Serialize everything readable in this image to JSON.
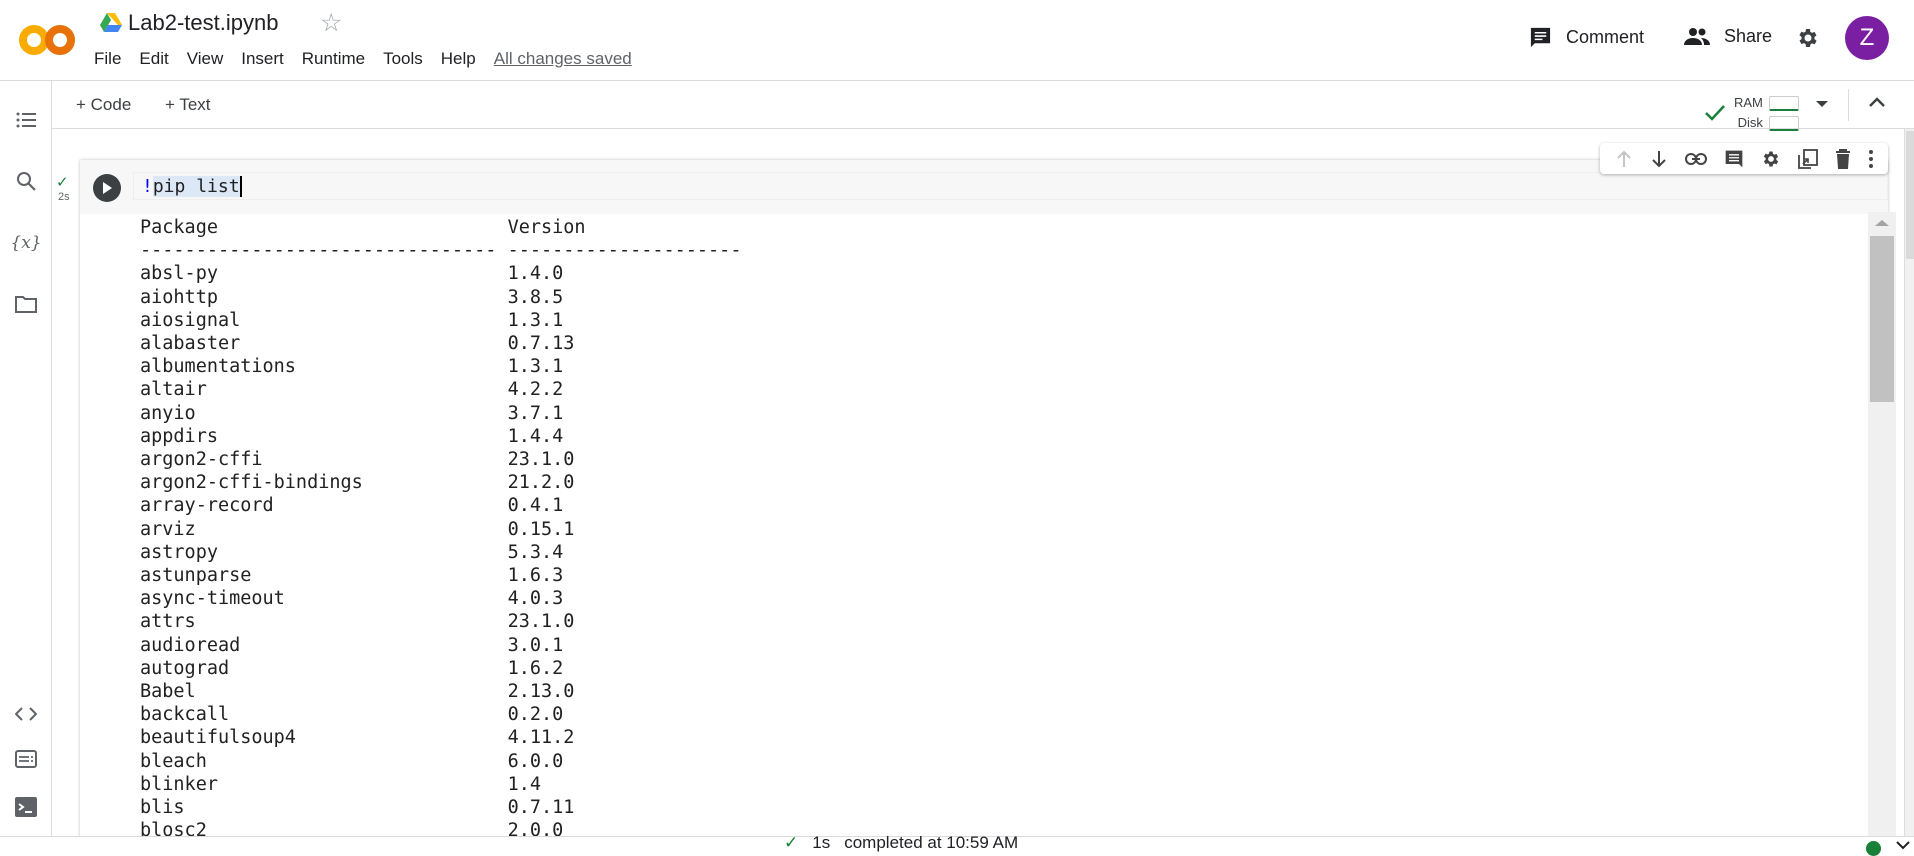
{
  "app": {
    "name": "Colab",
    "logo_text": "CO",
    "brand_colors": {
      "logo_orange": "#f9ab00",
      "logo_dark": "#e8710a",
      "avatar": "#7b1fa2",
      "success": "#188038"
    }
  },
  "header": {
    "title": "Lab2-test.ipynb",
    "menu": [
      "File",
      "Edit",
      "View",
      "Insert",
      "Runtime",
      "Tools",
      "Help"
    ],
    "save_status": "All changes saved",
    "comment_label": "Comment",
    "share_label": "Share",
    "avatar_initial": "Z"
  },
  "toolbar": {
    "add_code": "+ Code",
    "add_text": "+ Text",
    "ram_label": "RAM",
    "disk_label": "Disk"
  },
  "sidebar": {
    "icons": [
      "table-of-contents-icon",
      "search-icon",
      "variables-icon",
      "folder-icon",
      "code-snippets-icon",
      "command-palette-icon",
      "terminal-icon"
    ],
    "variables_glyph": "{x}"
  },
  "cell": {
    "code_bang": "!",
    "code_rest": "pip list",
    "exec_time": "2s",
    "tools": [
      "move-up-icon",
      "move-down-icon",
      "link-icon",
      "comment-icon",
      "settings-icon",
      "mirror-cell-icon",
      "delete-icon",
      "more-icon"
    ]
  },
  "output": {
    "headers": [
      "Package",
      "Version"
    ],
    "dash_widths": [
      32,
      21
    ],
    "rows": [
      [
        "absl-py",
        "1.4.0"
      ],
      [
        "aiohttp",
        "3.8.5"
      ],
      [
        "aiosignal",
        "1.3.1"
      ],
      [
        "alabaster",
        "0.7.13"
      ],
      [
        "albumentations",
        "1.3.1"
      ],
      [
        "altair",
        "4.2.2"
      ],
      [
        "anyio",
        "3.7.1"
      ],
      [
        "appdirs",
        "1.4.4"
      ],
      [
        "argon2-cffi",
        "23.1.0"
      ],
      [
        "argon2-cffi-bindings",
        "21.2.0"
      ],
      [
        "array-record",
        "0.4.1"
      ],
      [
        "arviz",
        "0.15.1"
      ],
      [
        "astropy",
        "5.3.4"
      ],
      [
        "astunparse",
        "1.6.3"
      ],
      [
        "async-timeout",
        "4.0.3"
      ],
      [
        "attrs",
        "23.1.0"
      ],
      [
        "audioread",
        "3.0.1"
      ],
      [
        "autograd",
        "1.6.2"
      ],
      [
        "Babel",
        "2.13.0"
      ],
      [
        "backcall",
        "0.2.0"
      ],
      [
        "beautifulsoup4",
        "4.11.2"
      ],
      [
        "bleach",
        "6.0.0"
      ],
      [
        "blinker",
        "1.4"
      ],
      [
        "blis",
        "0.7.11"
      ],
      [
        "blosc2",
        "2.0.0"
      ]
    ]
  },
  "status": {
    "duration": "1s",
    "completed": "completed at 10:59 AM"
  }
}
